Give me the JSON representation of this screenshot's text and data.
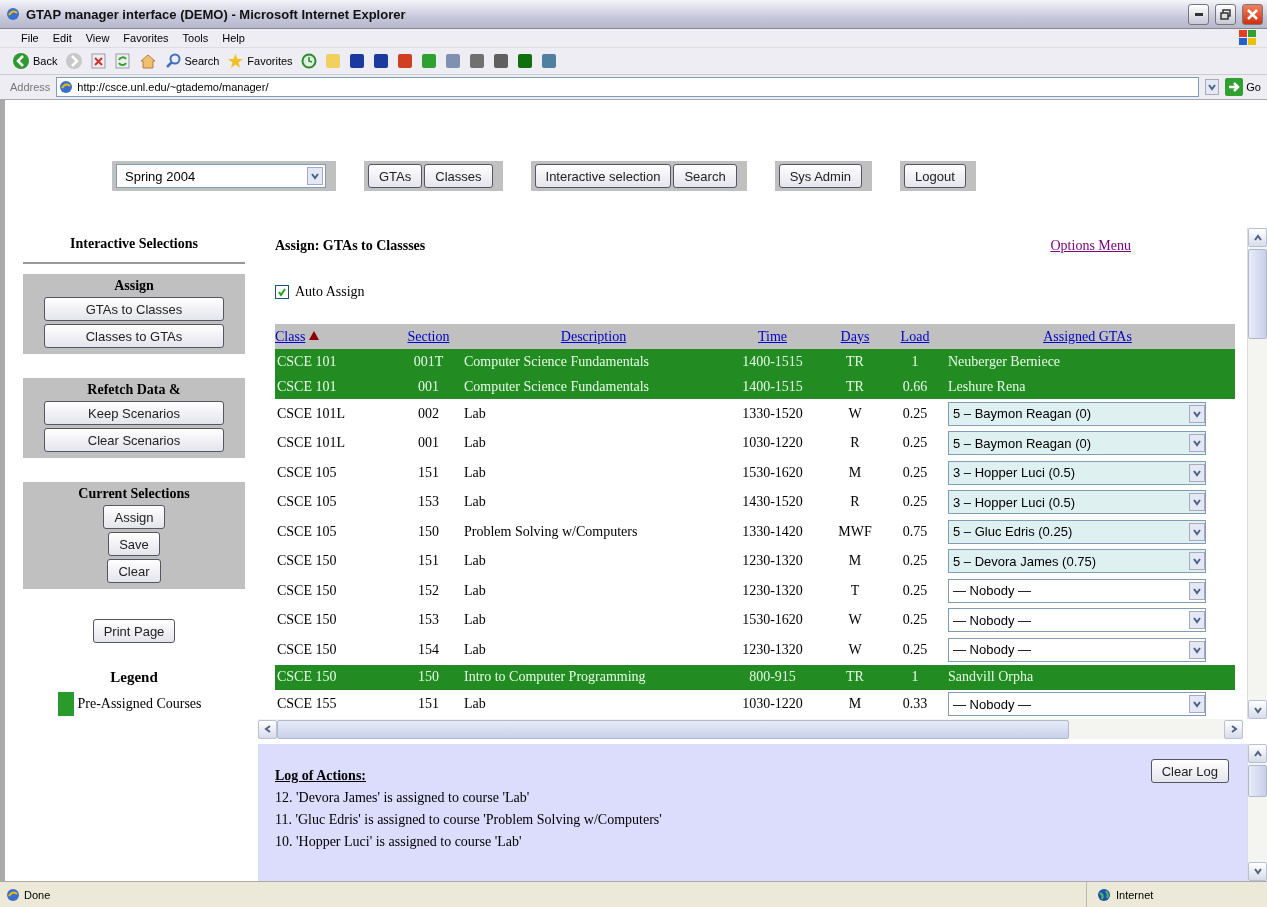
{
  "window": {
    "title": "GTAP manager interface (DEMO) - Microsoft Internet Explorer"
  },
  "menu": [
    "File",
    "Edit",
    "View",
    "Favorites",
    "Tools",
    "Help"
  ],
  "toolbar": {
    "back": "Back",
    "search": "Search",
    "favorites": "Favorites"
  },
  "address": {
    "label": "Address",
    "url": "http://csce.unl.edu/~gtademo/manager/",
    "go": "Go"
  },
  "topbar": {
    "semester": "Spring 2004",
    "groups": [
      [
        "GTAs",
        "Classes"
      ],
      [
        "Interactive selection",
        "Search"
      ],
      [
        "Sys Admin"
      ],
      [
        "Logout"
      ]
    ]
  },
  "sidebar": {
    "title": "Interactive Selections",
    "panels": [
      {
        "title": "Assign",
        "buttons": [
          "GTAs to Classes",
          "Classes to GTAs"
        ],
        "wide": true
      },
      {
        "title": "Refetch Data &",
        "buttons": [
          "Keep Scenarios",
          "Clear Scenarios"
        ],
        "wide": true
      },
      {
        "title": "Current Selections",
        "buttons": [
          "Assign",
          "Save",
          "Clear"
        ],
        "wide": false
      }
    ],
    "print": "Print Page",
    "legend_title": "Legend",
    "legend": [
      {
        "label": "Pre-Assigned Courses",
        "color": "#2a9a2a"
      }
    ]
  },
  "main": {
    "title": "Assign: GTAs to Classses",
    "options_link": "Options Menu",
    "auto_assign": {
      "label": "Auto Assign",
      "checked": true
    }
  },
  "table": {
    "columns": [
      {
        "label": "Class",
        "sorted": true
      },
      {
        "label": "Section",
        "sorted": false
      },
      {
        "label": "Description",
        "sorted": false
      },
      {
        "label": "Time",
        "sorted": false
      },
      {
        "label": "Days",
        "sorted": false
      },
      {
        "label": "Load",
        "sorted": false
      },
      {
        "label": "Assigned GTAs",
        "sorted": false
      }
    ],
    "rows": [
      {
        "class": "CSCE 101",
        "section": "001T",
        "description": "Computer Science Fundamentals",
        "time": "1400-1515",
        "days": "TR",
        "load": "1",
        "kind": "text",
        "gta": "Neuberger Berniece",
        "pre_assigned": true
      },
      {
        "class": "CSCE 101",
        "section": "001",
        "description": "Computer Science Fundamentals",
        "time": "1400-1515",
        "days": "TR",
        "load": "0.66",
        "kind": "text",
        "gta": "Leshure Rena",
        "pre_assigned": true
      },
      {
        "class": "CSCE 101L",
        "section": "002",
        "description": "Lab",
        "time": "1330-1520",
        "days": "W",
        "load": "0.25",
        "kind": "select",
        "gta": "5 – Baymon Reagan (0)",
        "pre_assigned": false,
        "has_gta": true
      },
      {
        "class": "CSCE 101L",
        "section": "001",
        "description": "Lab",
        "time": "1030-1220",
        "days": "R",
        "load": "0.25",
        "kind": "select",
        "gta": "5 – Baymon Reagan (0)",
        "pre_assigned": false,
        "has_gta": true
      },
      {
        "class": "CSCE 105",
        "section": "151",
        "description": "Lab",
        "time": "1530-1620",
        "days": "M",
        "load": "0.25",
        "kind": "select",
        "gta": "3 – Hopper Luci (0.5)",
        "pre_assigned": false,
        "has_gta": true
      },
      {
        "class": "CSCE 105",
        "section": "153",
        "description": "Lab",
        "time": "1430-1520",
        "days": "R",
        "load": "0.25",
        "kind": "select",
        "gta": "3 – Hopper Luci (0.5)",
        "pre_assigned": false,
        "has_gta": true
      },
      {
        "class": "CSCE 105",
        "section": "150",
        "description": "Problem Solving w/Computers",
        "time": "1330-1420",
        "days": "MWF",
        "load": "0.75",
        "kind": "select",
        "gta": "5 – Gluc Edris (0.25)",
        "pre_assigned": false,
        "has_gta": true
      },
      {
        "class": "CSCE 150",
        "section": "151",
        "description": "Lab",
        "time": "1230-1320",
        "days": "M",
        "load": "0.25",
        "kind": "select",
        "gta": "5 – Devora James (0.75)",
        "pre_assigned": false,
        "has_gta": true
      },
      {
        "class": "CSCE 150",
        "section": "152",
        "description": "Lab",
        "time": "1230-1320",
        "days": "T",
        "load": "0.25",
        "kind": "select",
        "gta": "— Nobody —",
        "pre_assigned": false,
        "has_gta": false
      },
      {
        "class": "CSCE 150",
        "section": "153",
        "description": "Lab",
        "time": "1530-1620",
        "days": "W",
        "load": "0.25",
        "kind": "select",
        "gta": "— Nobody —",
        "pre_assigned": false,
        "has_gta": false
      },
      {
        "class": "CSCE 150",
        "section": "154",
        "description": "Lab",
        "time": "1230-1320",
        "days": "W",
        "load": "0.25",
        "kind": "select",
        "gta": "— Nobody —",
        "pre_assigned": false,
        "has_gta": false
      },
      {
        "class": "CSCE 150",
        "section": "150",
        "description": "Intro to Computer Programming",
        "time": "800-915",
        "days": "TR",
        "load": "1",
        "kind": "text",
        "gta": "Sandvill Orpha",
        "pre_assigned": true
      },
      {
        "class": "CSCE 155",
        "section": "151",
        "description": "Lab",
        "time": "1030-1220",
        "days": "M",
        "load": "0.33",
        "kind": "select",
        "gta": "— Nobody —",
        "pre_assigned": false,
        "has_gta": false
      }
    ]
  },
  "log": {
    "title": "Log of Actions:",
    "clear": "Clear Log",
    "entries": [
      "12. 'Devora James' is assigned to course 'Lab'",
      "11. 'Gluc Edris' is assigned to course 'Problem Solving w/Computers'",
      "10. 'Hopper Luci' is assigned to course 'Lab'"
    ]
  },
  "status_bar": {
    "text": "Done",
    "zone": "Internet"
  }
}
